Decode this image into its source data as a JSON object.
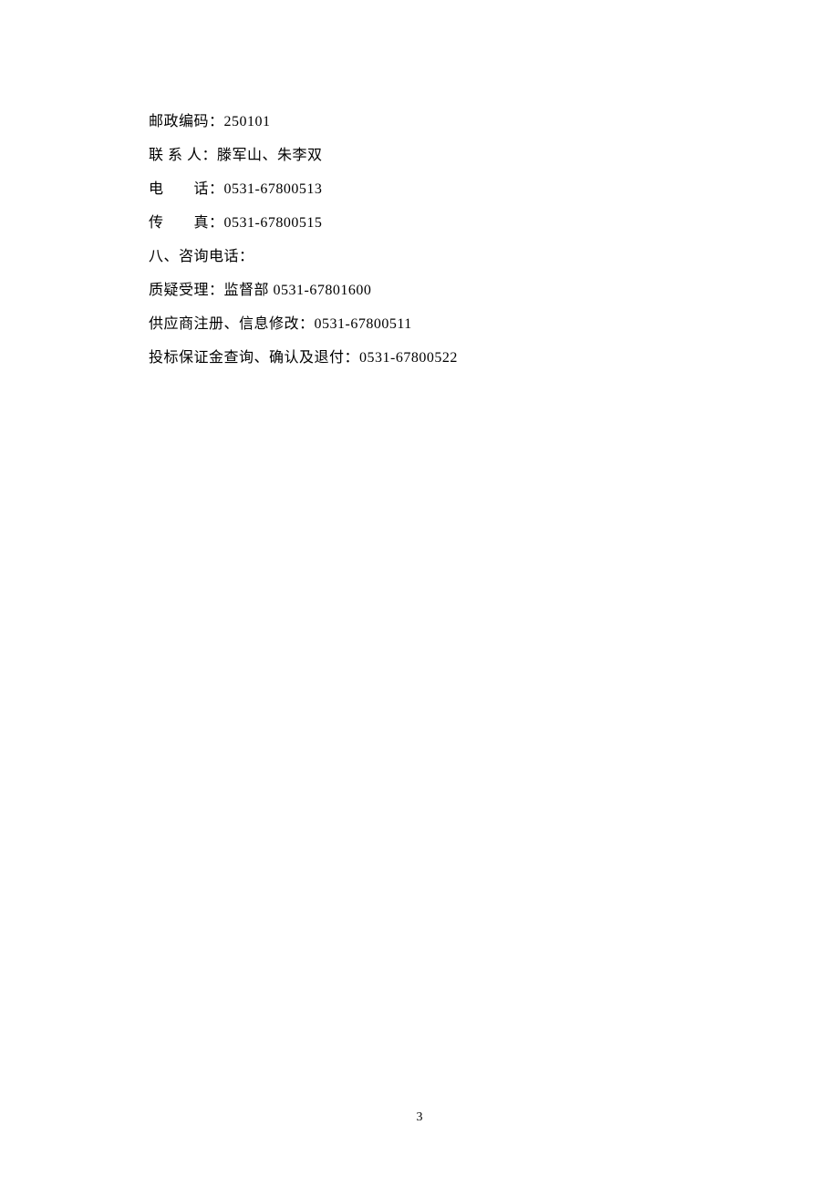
{
  "lines": {
    "postal_code": "邮政编码：250101",
    "contact": "联 系 人：滕军山、朱李双",
    "phone": "电　　话：0531-67800513",
    "fax": "传　　真：0531-67800515",
    "section8": "八、咨询电话：",
    "complaint": "质疑受理：监督部 0531-67801600",
    "supplier": "供应商注册、信息修改：0531-67800511",
    "deposit": "投标保证金查询、确认及退付：0531-67800522"
  },
  "page_number": "3"
}
